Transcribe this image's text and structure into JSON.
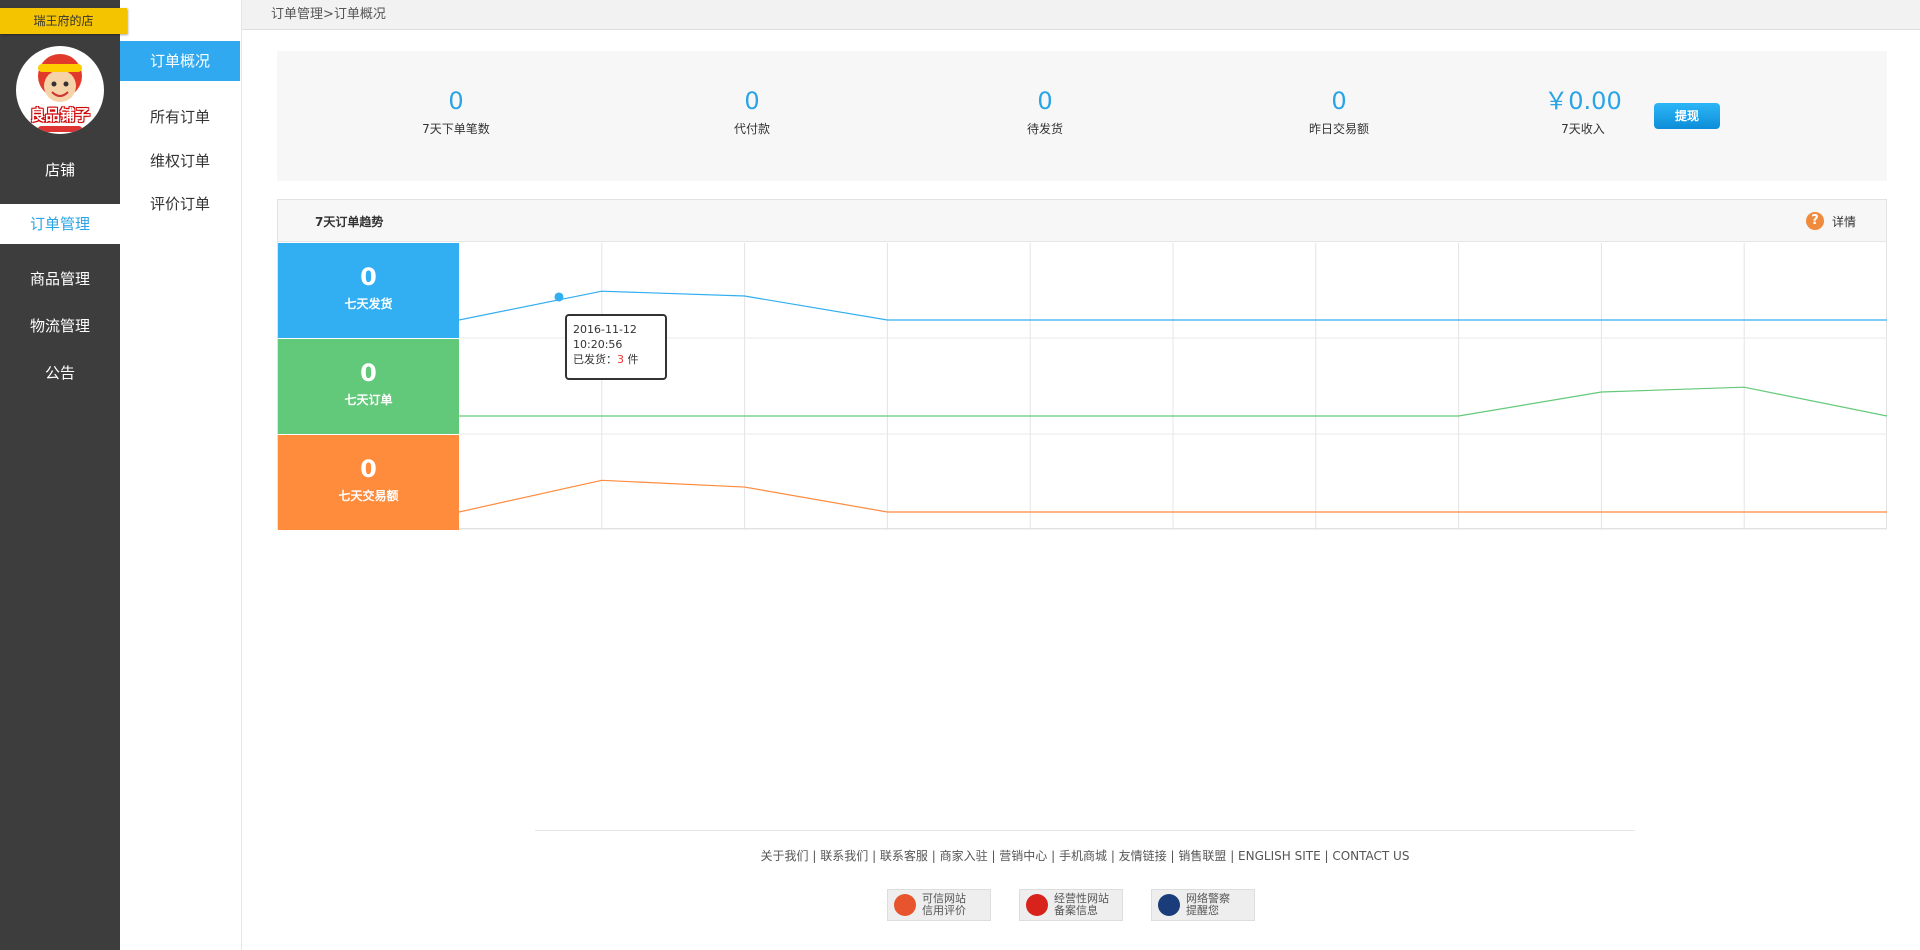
{
  "shop": {
    "name": "瑞王府的店",
    "logo_text": "良品铺子"
  },
  "nav": {
    "items": [
      {
        "label": "店铺"
      },
      {
        "label": "订单管理"
      },
      {
        "label": "商品管理"
      },
      {
        "label": "物流管理"
      },
      {
        "label": "公告"
      }
    ],
    "active_color": "#2aa4e5"
  },
  "subnav": {
    "items": [
      {
        "label": "订单概况"
      },
      {
        "label": "所有订单"
      },
      {
        "label": "维权订单"
      },
      {
        "label": "评价订单"
      }
    ]
  },
  "breadcrumb": "订单管理>订单概况",
  "stats": {
    "items": [
      {
        "value": "0",
        "label": "7天下单笔数"
      },
      {
        "value": "0",
        "label": "代付款"
      },
      {
        "value": "0",
        "label": "待发货"
      },
      {
        "value": "0",
        "label": "昨日交易额"
      },
      {
        "value": "￥0.00",
        "label": "7天收入"
      }
    ],
    "withdraw_label": "提现"
  },
  "trend": {
    "title": "7天订单趋势",
    "detail_label": "详情",
    "help_glyph": "?",
    "boxes": [
      {
        "value": "0",
        "label": "七天发货",
        "color": "#32aef2"
      },
      {
        "value": "0",
        "label": "七天订单",
        "color": "#63c97a"
      },
      {
        "value": "0",
        "label": "七天交易额",
        "color": "#ff8b3d"
      }
    ],
    "tooltip": {
      "date": "2016-11-12",
      "time": "10:20:56",
      "prefix": "已发货：",
      "count": "3",
      "suffix": " 件"
    }
  },
  "chart_data": {
    "type": "line",
    "x": [
      0,
      1,
      2,
      3,
      4,
      5,
      6,
      7,
      8,
      9,
      10
    ],
    "series": [
      {
        "values": [
          0,
          0.3,
          0.25,
          0,
          0,
          0,
          0,
          0,
          0,
          0,
          0
        ],
        "color": "#32aef2"
      },
      {
        "values": [
          0,
          0,
          0,
          0,
          0,
          0,
          0,
          0.25,
          0.3,
          0
        ],
        "color": "#63c97a"
      },
      {
        "values": [
          0,
          0.33,
          0.26,
          0,
          0,
          0,
          0,
          0,
          0,
          0,
          0
        ],
        "color": "#ff8b3d"
      }
    ],
    "highlight_point": {
      "series": 0,
      "x": 0.7,
      "y": 0.24
    },
    "grid": true
  },
  "footer": {
    "links": [
      "关于我们",
      "联系我们",
      "联系客服",
      "商家入驻",
      "营销中心",
      "手机商城",
      "友情链接",
      "销售联盟",
      "ENGLISH SITE",
      "CONTACT US"
    ],
    "badges": [
      {
        "line1": "可信网站",
        "line2": "信用评价",
        "icon": "trust-icon",
        "color": "#e8542d"
      },
      {
        "line1": "经营性网站",
        "line2": "备案信息",
        "icon": "police-badge-icon",
        "color": "#d8221c"
      },
      {
        "line1": "网络警察",
        "line2": "提醒您",
        "icon": "cyber-police-icon",
        "color": "#1a3c7a"
      }
    ]
  }
}
